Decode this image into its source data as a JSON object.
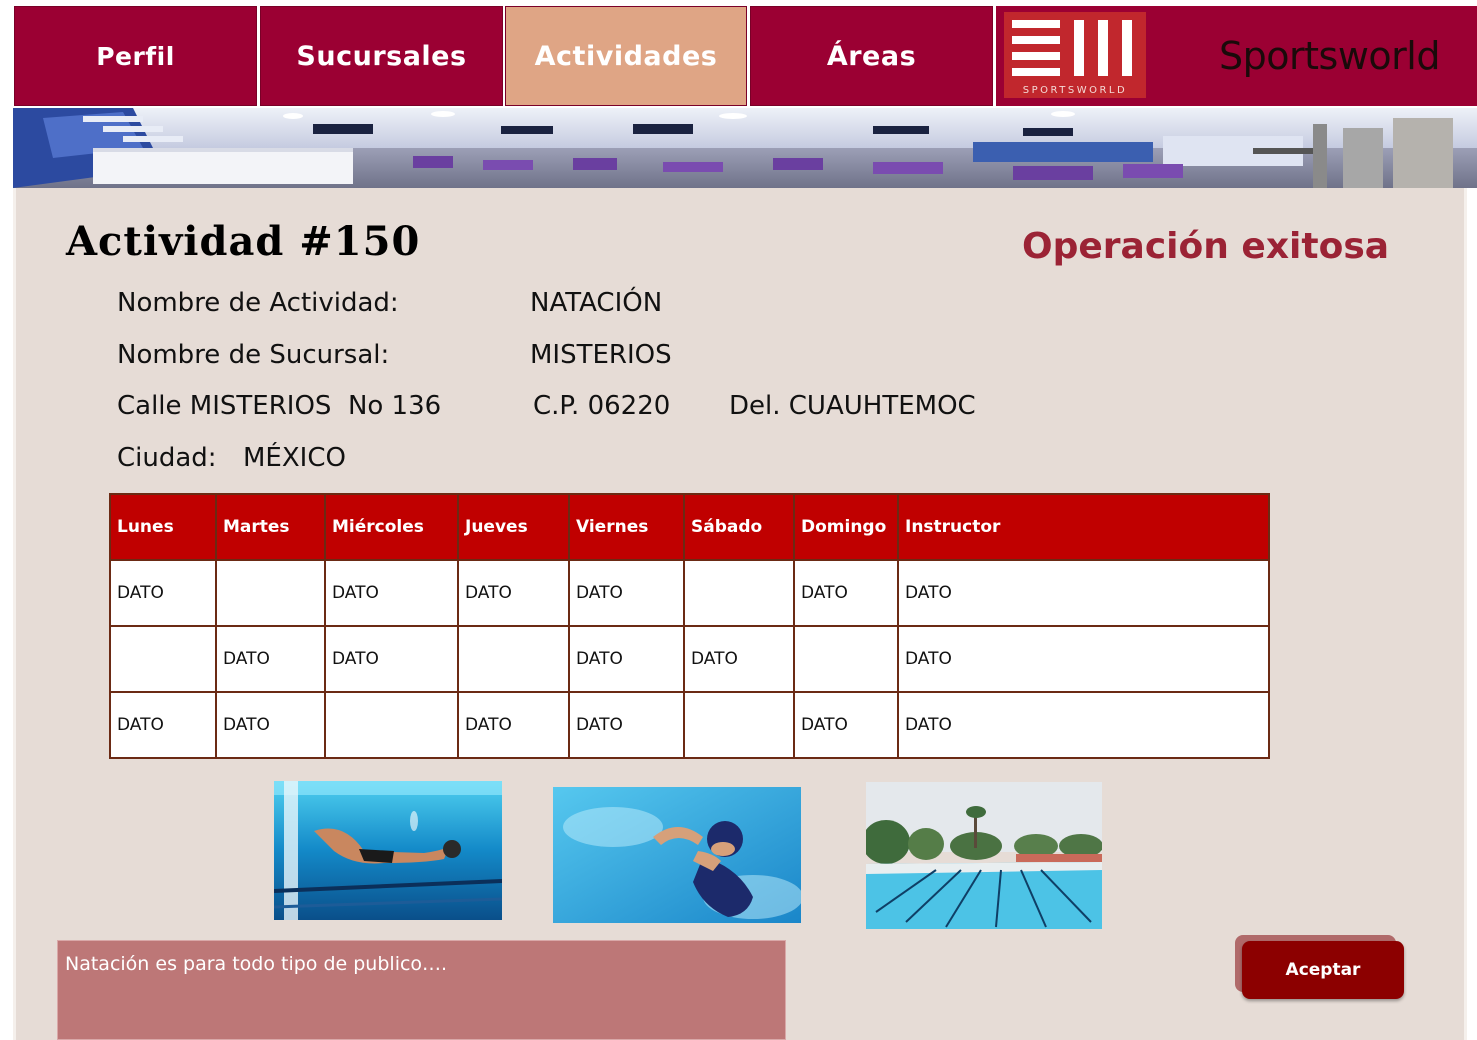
{
  "nav": {
    "tabs": [
      {
        "label": "Perfil",
        "active": false
      },
      {
        "label": "Sucursales",
        "active": false
      },
      {
        "label": "Actividades",
        "active": true
      },
      {
        "label": "Áreas",
        "active": false
      }
    ],
    "logo_text": "SPORTSWORLD",
    "brand_name": "Sportsworld"
  },
  "colors": {
    "primary": "#9b0033",
    "active_tab": "#dfa585",
    "table_header": "#c00000",
    "success_text": "#9b2335",
    "panel_bg": "#e6dcd6",
    "description_bg": "#bd7777",
    "button_bg": "#8c0000"
  },
  "activity": {
    "title": "Actividad #150",
    "status_message": "Operación exitosa",
    "name_label": "Nombre de Actividad:",
    "name_value": "NATACIÓN",
    "branch_label": "Nombre de Sucursal:",
    "branch_value": "MISTERIOS",
    "address_street": "Calle MISTERIOS  No 136",
    "address_cp": "C.P. 06220",
    "address_del": "Del. CUAUHTEMOC",
    "city_label": "Ciudad:",
    "city_value": "MÉXICO"
  },
  "schedule": {
    "headers": [
      "Lunes",
      "Martes",
      "Miércoles",
      "Jueves",
      "Viernes",
      "Sábado",
      "Domingo",
      "Instructor"
    ],
    "rows": [
      [
        "DATO",
        "",
        "DATO",
        "DATO",
        "DATO",
        "",
        "DATO",
        "DATO"
      ],
      [
        "",
        "DATO",
        "DATO",
        "",
        "DATO",
        "DATO",
        "",
        "DATO"
      ],
      [
        "DATO",
        "DATO",
        "",
        "DATO",
        "DATO",
        "",
        "DATO",
        "DATO"
      ]
    ]
  },
  "description": {
    "text": "Natación es para todo tipo de publico…."
  },
  "actions": {
    "accept_label": "Aceptar"
  }
}
